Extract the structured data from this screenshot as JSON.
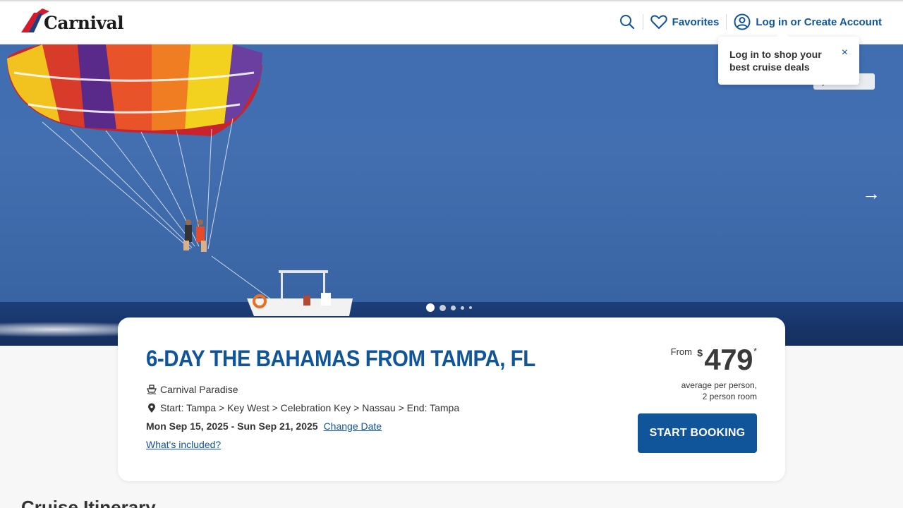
{
  "brand": {
    "name": "Carnival",
    "reg_mark": "®",
    "primary_color": "#10559a"
  },
  "nav": {
    "search_icon": "search-icon",
    "favorites_label": "Favorites",
    "login_label": "Log in or Create Account"
  },
  "tooltip": {
    "text": "Log in to shop your best cruise deals",
    "close_label": "×"
  },
  "hero": {
    "badge_text": "y    est",
    "next_arrow": "→",
    "slides_count": 5,
    "active_slide": 1
  },
  "cruise": {
    "title": "6-DAY THE BAHAMAS FROM TAMPA, FL",
    "ship": "Carnival Paradise",
    "route": "Start: Tampa > Key West > Celebration Key > Nassau > End: Tampa",
    "dates": "Mon Sep 15, 2025 - Sun Sep 21, 2025",
    "change_date_label": "Change Date",
    "whats_included_label": "What's included?"
  },
  "price": {
    "from_label": "From",
    "currency": "$",
    "amount": "479",
    "asterisk": "*",
    "note_line1": "average per person,",
    "note_line2": "2 person room"
  },
  "cta": {
    "start_booking_label": "START BOOKING"
  },
  "section": {
    "itinerary_title": "Cruise Itinerary"
  }
}
